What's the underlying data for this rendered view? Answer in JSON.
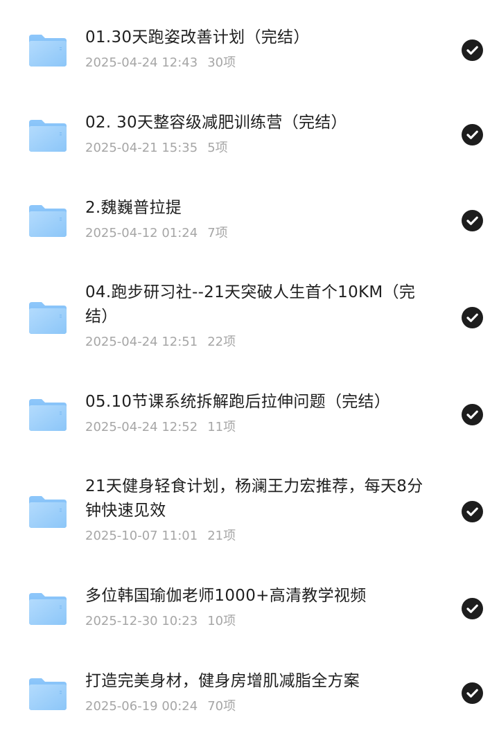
{
  "items": [
    {
      "title": "01.30天跑姿改善计划（完结）",
      "date": "2025-04-24 12:43",
      "count": "30项",
      "selected": true
    },
    {
      "title": "02. 30天整容级减肥训练营（完结）",
      "date": "2025-04-21 15:35",
      "count": "5项",
      "selected": true
    },
    {
      "title": "2.魏巍普拉提",
      "date": "2025-04-12 01:24",
      "count": "7项",
      "selected": true
    },
    {
      "title": "04.跑步研习社--21天突破人生首个10KM（完结）",
      "date": "2025-04-24 12:51",
      "count": "22项",
      "selected": true
    },
    {
      "title": "05.10节课系统拆解跑后拉伸问题（完结）",
      "date": "2025-04-24 12:52",
      "count": "11项",
      "selected": true
    },
    {
      "title": "21天健身轻食计划，杨澜王力宏推荐，每天8分钟快速见效",
      "date": "2025-10-07 11:01",
      "count": "21项",
      "selected": true
    },
    {
      "title": "多位韩国瑜伽老师1000+高清教学视频",
      "date": "2025-12-30 10:23",
      "count": "10项",
      "selected": true
    },
    {
      "title": "打造完美身材，健身房增肌减脂全方案",
      "date": "2025-06-19 00:24",
      "count": "70项",
      "selected": true
    }
  ],
  "icons": {
    "folder": "folder-icon",
    "check": "checkmark-circle-icon"
  },
  "colors": {
    "folder_light": "#a8d4fb",
    "folder_dark": "#6db4f5",
    "check_bg": "#1d1d1d",
    "meta_text": "#a6a6a6"
  }
}
